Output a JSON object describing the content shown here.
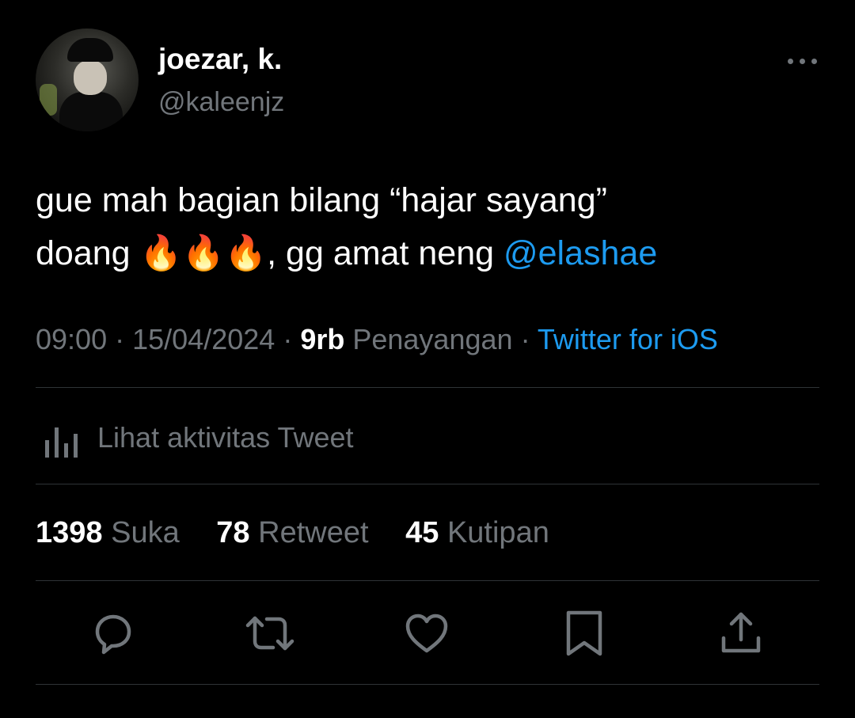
{
  "author": {
    "display_name": "joezar, k.",
    "handle": "@kaleenjz"
  },
  "icons": {
    "more": "more-horizontal-icon",
    "activity": "bar-chart-icon",
    "reply": "reply-icon",
    "retweet": "retweet-icon",
    "like": "heart-icon",
    "bookmark": "bookmark-icon",
    "share": "share-icon"
  },
  "tweet": {
    "line1": "gue mah bagian bilang “hajar sayang”",
    "line2_prefix": "doang ",
    "emojis": "🔥🔥🔥",
    "line2_suffix": ", gg amat neng ",
    "mention": "@elashae"
  },
  "meta": {
    "time": "09:00",
    "date": "15/04/2024",
    "views_count": "9rb",
    "views_label": "Penayangan",
    "source": "Twitter for iOS"
  },
  "activity_label": "Lihat aktivitas Tweet",
  "stats": [
    {
      "count": "1398",
      "label": "Suka"
    },
    {
      "count": "78",
      "label": "Retweet"
    },
    {
      "count": "45",
      "label": "Kutipan"
    }
  ],
  "colors": {
    "background": "#000000",
    "text": "#ffffff",
    "secondary": "#71767b",
    "accent": "#1d9bf0",
    "divider": "#2f3336"
  }
}
